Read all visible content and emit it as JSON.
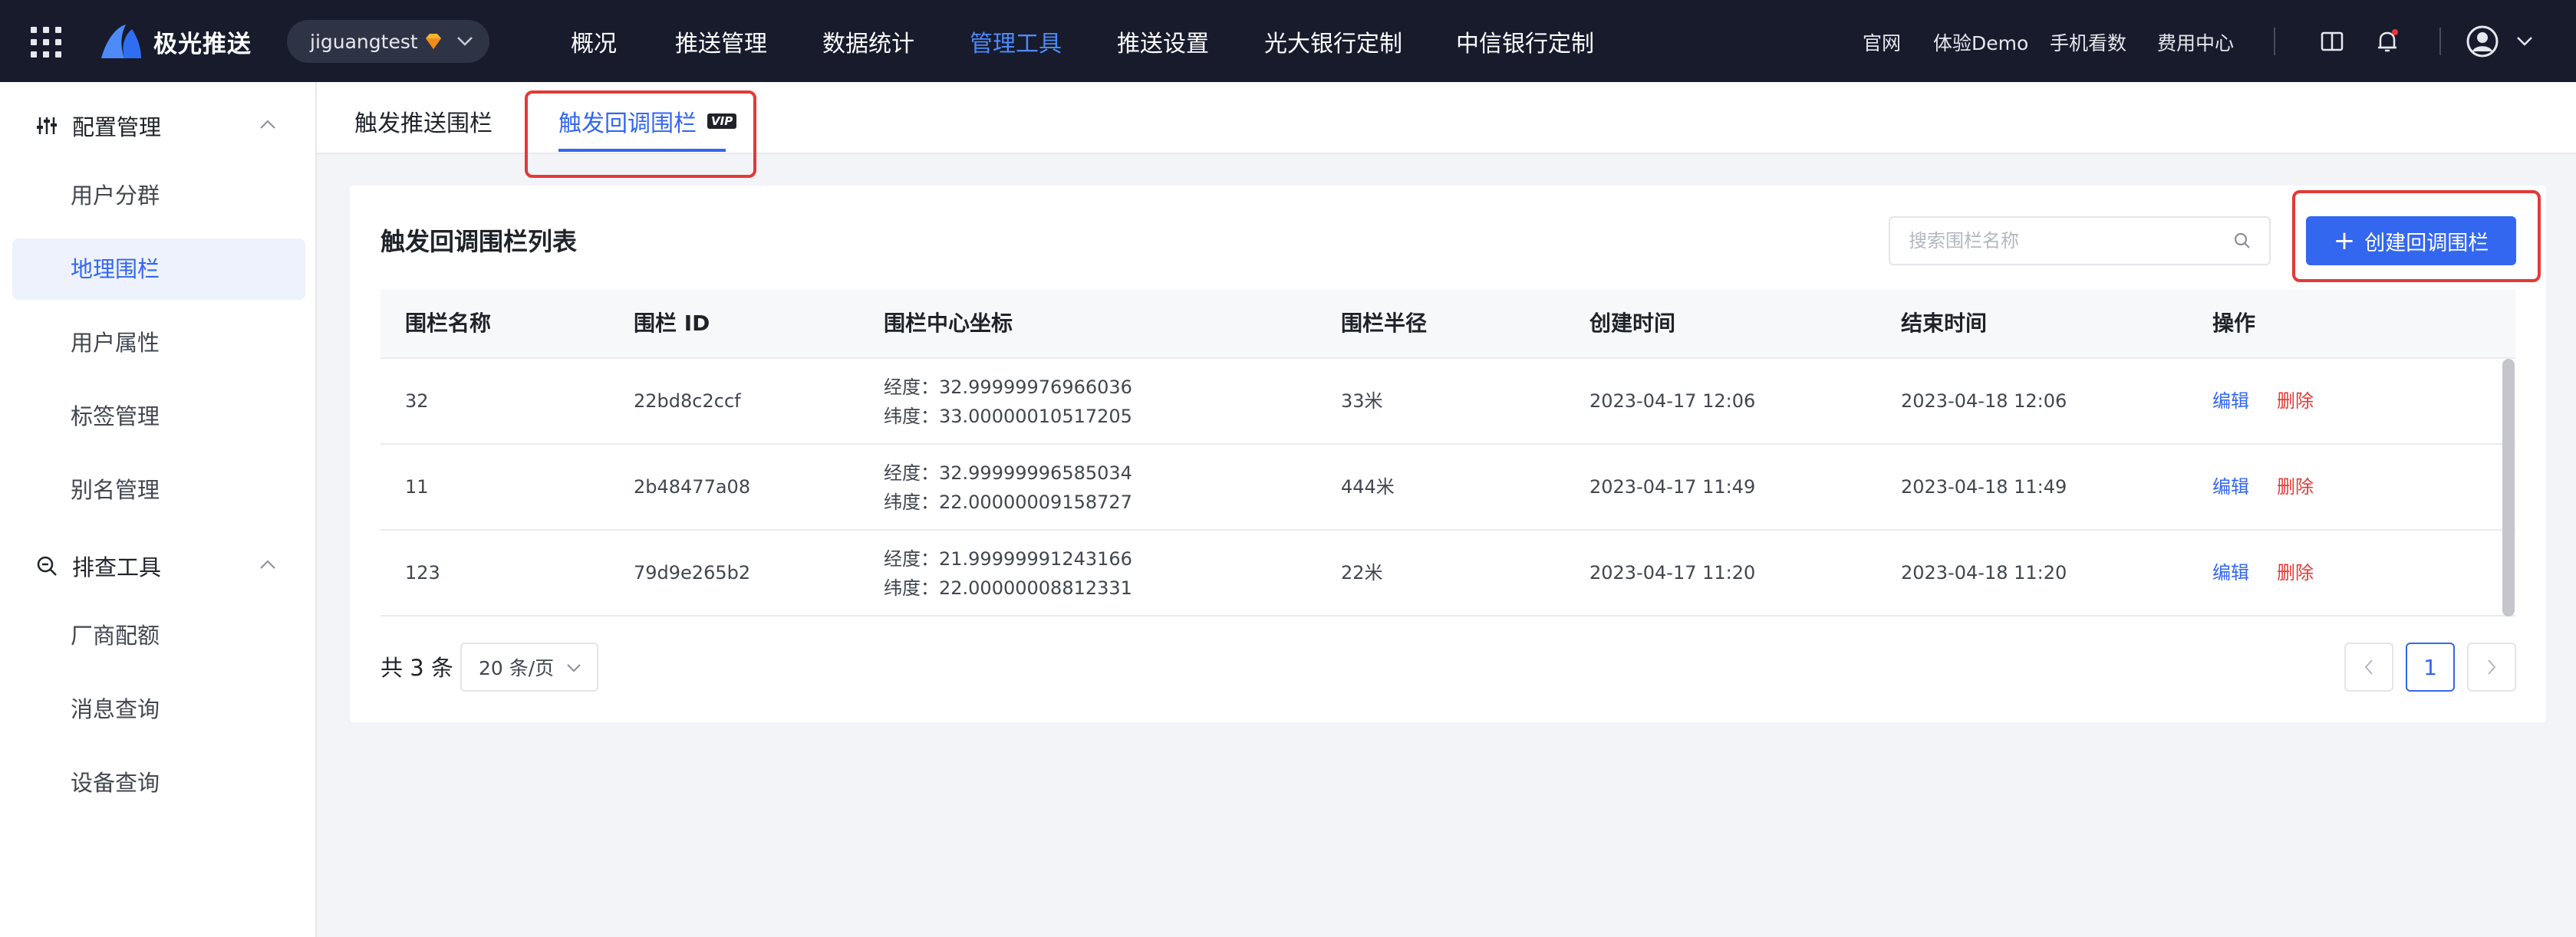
{
  "topbar": {
    "brand": "极光推送",
    "app": "jiguangtest",
    "nav": [
      "概况",
      "推送管理",
      "数据统计",
      "管理工具",
      "推送设置",
      "光大银行定制",
      "中信银行定制"
    ],
    "active_nav": "管理工具",
    "links": [
      "官网",
      "体验Demo",
      "手机看数",
      "费用中心"
    ]
  },
  "sidebar": {
    "group1": "配置管理",
    "group1_items": [
      "用户分群",
      "地理围栏",
      "用户属性",
      "标签管理",
      "别名管理"
    ],
    "group2": "排查工具",
    "group2_items": [
      "厂商配额",
      "消息查询",
      "设备查询"
    ],
    "active_item": "地理围栏"
  },
  "tabs": {
    "items": [
      "触发推送围栏",
      "触发回调围栏"
    ],
    "active": "触发回调围栏",
    "vip_badge": "VIP"
  },
  "card": {
    "title": "触发回调围栏列表",
    "search_placeholder": "搜索围栏名称",
    "create_button": "创建回调围栏"
  },
  "table": {
    "columns": [
      "围栏名称",
      "围栏 ID",
      "围栏中心坐标",
      "围栏半径",
      "创建时间",
      "结束时间",
      "操作"
    ],
    "rows": [
      {
        "name": "32",
        "id": "22bd8c2ccf",
        "lng": "经度：32.99999976966036",
        "lat": "纬度：33.00000010517205",
        "radius": "33米",
        "created": "2023-04-17 12:06",
        "ended": "2023-04-18 12:06",
        "edit": "编辑",
        "delete": "删除"
      },
      {
        "name": "11",
        "id": "2b48477a08",
        "lng": "经度：32.99999996585034",
        "lat": "纬度：22.00000009158727",
        "radius": "444米",
        "created": "2023-04-17 11:49",
        "ended": "2023-04-18 11:49",
        "edit": "编辑",
        "delete": "删除"
      },
      {
        "name": "123",
        "id": "79d9e265b2",
        "lng": "经度：21.99999991243166",
        "lat": "纬度：22.00000008812331",
        "radius": "22米",
        "created": "2023-04-17 11:20",
        "ended": "2023-04-18 11:20",
        "edit": "编辑",
        "delete": "删除"
      }
    ]
  },
  "pagination": {
    "total": "共 3 条",
    "page_size": "20 条/页",
    "current_page": "1"
  },
  "colors": {
    "topbar_bg": "#171b2c",
    "accent": "#3367f0",
    "danger": "#e33a36",
    "highlight_box": "#e33a36"
  }
}
